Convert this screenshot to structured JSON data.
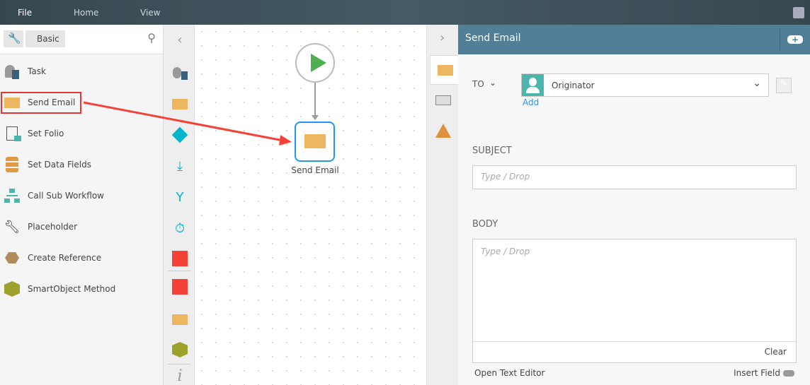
{
  "menu": {
    "file": "File",
    "home": "Home",
    "view": "View"
  },
  "toolbox": {
    "breadcrumb": "Basic",
    "items": [
      {
        "label": "Task",
        "icon": "task-icon"
      },
      {
        "label": "Send Email",
        "icon": "email-icon"
      },
      {
        "label": "Set Folio",
        "icon": "folio-icon"
      },
      {
        "label": "Set Data Fields",
        "icon": "data-fields-icon"
      },
      {
        "label": "Call Sub Workflow",
        "icon": "sub-workflow-icon"
      },
      {
        "label": "Placeholder",
        "icon": "wrench-icon"
      },
      {
        "label": "Create Reference",
        "icon": "reference-icon"
      },
      {
        "label": "SmartObject Method",
        "icon": "smartobject-icon"
      }
    ]
  },
  "canvas": {
    "node_label": "Send Email"
  },
  "panel": {
    "title": "Send Email",
    "to_label": "TO",
    "recipient": "Originator",
    "add_link": "Add",
    "subject_label": "SUBJECT",
    "subject_placeholder": "Type / Drop",
    "body_label": "BODY",
    "body_placeholder": "Type / Drop",
    "clear": "Clear",
    "open_text_editor": "Open Text Editor",
    "insert_field": "Insert Field"
  },
  "colors": {
    "header": "#527f98",
    "accent": "#2196f3",
    "highlight": "#e53935"
  }
}
